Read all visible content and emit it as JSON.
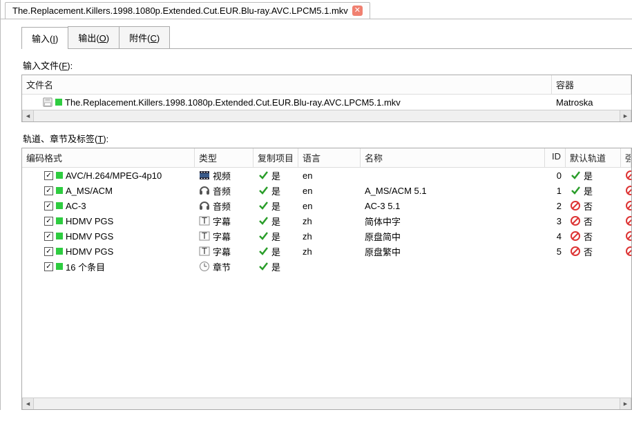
{
  "fileTab": {
    "title": "The.Replacement.Killers.1998.1080p.Extended.Cut.EUR.Blu-ray.AVC.LPCM5.1.mkv"
  },
  "tabs": {
    "input": {
      "label": "输入(",
      "accel": "I",
      "suffix": ")"
    },
    "output": {
      "label": "输出(",
      "accel": "O",
      "suffix": ")"
    },
    "attach": {
      "label": "附件(",
      "accel": "C",
      "suffix": ")"
    }
  },
  "inputFiles": {
    "label": "输入文件(",
    "accel": "F",
    "suffix": "):",
    "columns": {
      "name": "文件名",
      "container": "容器"
    },
    "rows": [
      {
        "name": "The.Replacement.Killers.1998.1080p.Extended.Cut.EUR.Blu-ray.AVC.LPCM5.1.mkv",
        "container": "Matroska"
      }
    ]
  },
  "tracks": {
    "label": "轨道、章节及标签(",
    "accel": "T",
    "suffix": "):",
    "columns": {
      "codec": "编码格式",
      "type": "类型",
      "copy": "复制项目",
      "lang": "语言",
      "name": "名称",
      "id": "ID",
      "default": "默认轨道",
      "forced": "强"
    },
    "rows": [
      {
        "checked": true,
        "codec": "AVC/H.264/MPEG-4p10",
        "typeIcon": "video",
        "type": "视频",
        "copy": "是",
        "lang": "en",
        "name": "",
        "id": "0",
        "defYes": true,
        "default": "是"
      },
      {
        "checked": true,
        "codec": "A_MS/ACM",
        "typeIcon": "audio",
        "type": "音频",
        "copy": "是",
        "lang": "en",
        "name": "A_MS/ACM 5.1",
        "id": "1",
        "defYes": true,
        "default": "是"
      },
      {
        "checked": true,
        "codec": "AC-3",
        "typeIcon": "audio",
        "type": "音频",
        "copy": "是",
        "lang": "en",
        "name": "AC-3 5.1",
        "id": "2",
        "defYes": false,
        "default": "否"
      },
      {
        "checked": true,
        "codec": "HDMV PGS",
        "typeIcon": "subtitle",
        "type": "字幕",
        "copy": "是",
        "lang": "zh",
        "name": "简体中字",
        "id": "3",
        "defYes": false,
        "default": "否"
      },
      {
        "checked": true,
        "codec": "HDMV PGS",
        "typeIcon": "subtitle",
        "type": "字幕",
        "copy": "是",
        "lang": "zh",
        "name": "原盘简中",
        "id": "4",
        "defYes": false,
        "default": "否"
      },
      {
        "checked": true,
        "codec": "HDMV PGS",
        "typeIcon": "subtitle",
        "type": "字幕",
        "copy": "是",
        "lang": "zh",
        "name": "原盘繁中",
        "id": "5",
        "defYes": false,
        "default": "否"
      },
      {
        "checked": true,
        "codec": "16 个条目",
        "typeIcon": "chapter",
        "type": "章节",
        "copy": "是",
        "lang": "",
        "name": "",
        "id": "",
        "defYes": null,
        "default": ""
      }
    ]
  }
}
